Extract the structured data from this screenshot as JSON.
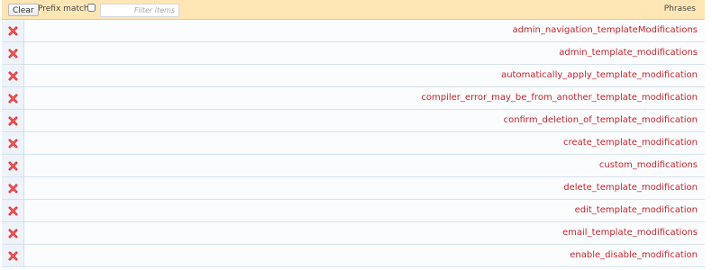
{
  "toolbar": {
    "clear_label": "Clear",
    "prefix_match_label": "Prefix match",
    "filter_placeholder": "Filter items",
    "column_header": "Phrases"
  },
  "colors": {
    "toolbar_bg": "#fde6b4",
    "link": "#c4242b",
    "delete_icon": "#e03131"
  },
  "phrases": [
    "admin_navigation_templateModifications",
    "admin_template_modifications",
    "automatically_apply_template_modification",
    "compiler_error_may_be_from_another_template_modification",
    "confirm_deletion_of_template_modification",
    "create_template_modification",
    "custom_modifications",
    "delete_template_modification",
    "edit_template_modification",
    "email_template_modifications",
    "enable_disable_modification"
  ],
  "icons": {
    "delete": "delete-x-icon"
  }
}
